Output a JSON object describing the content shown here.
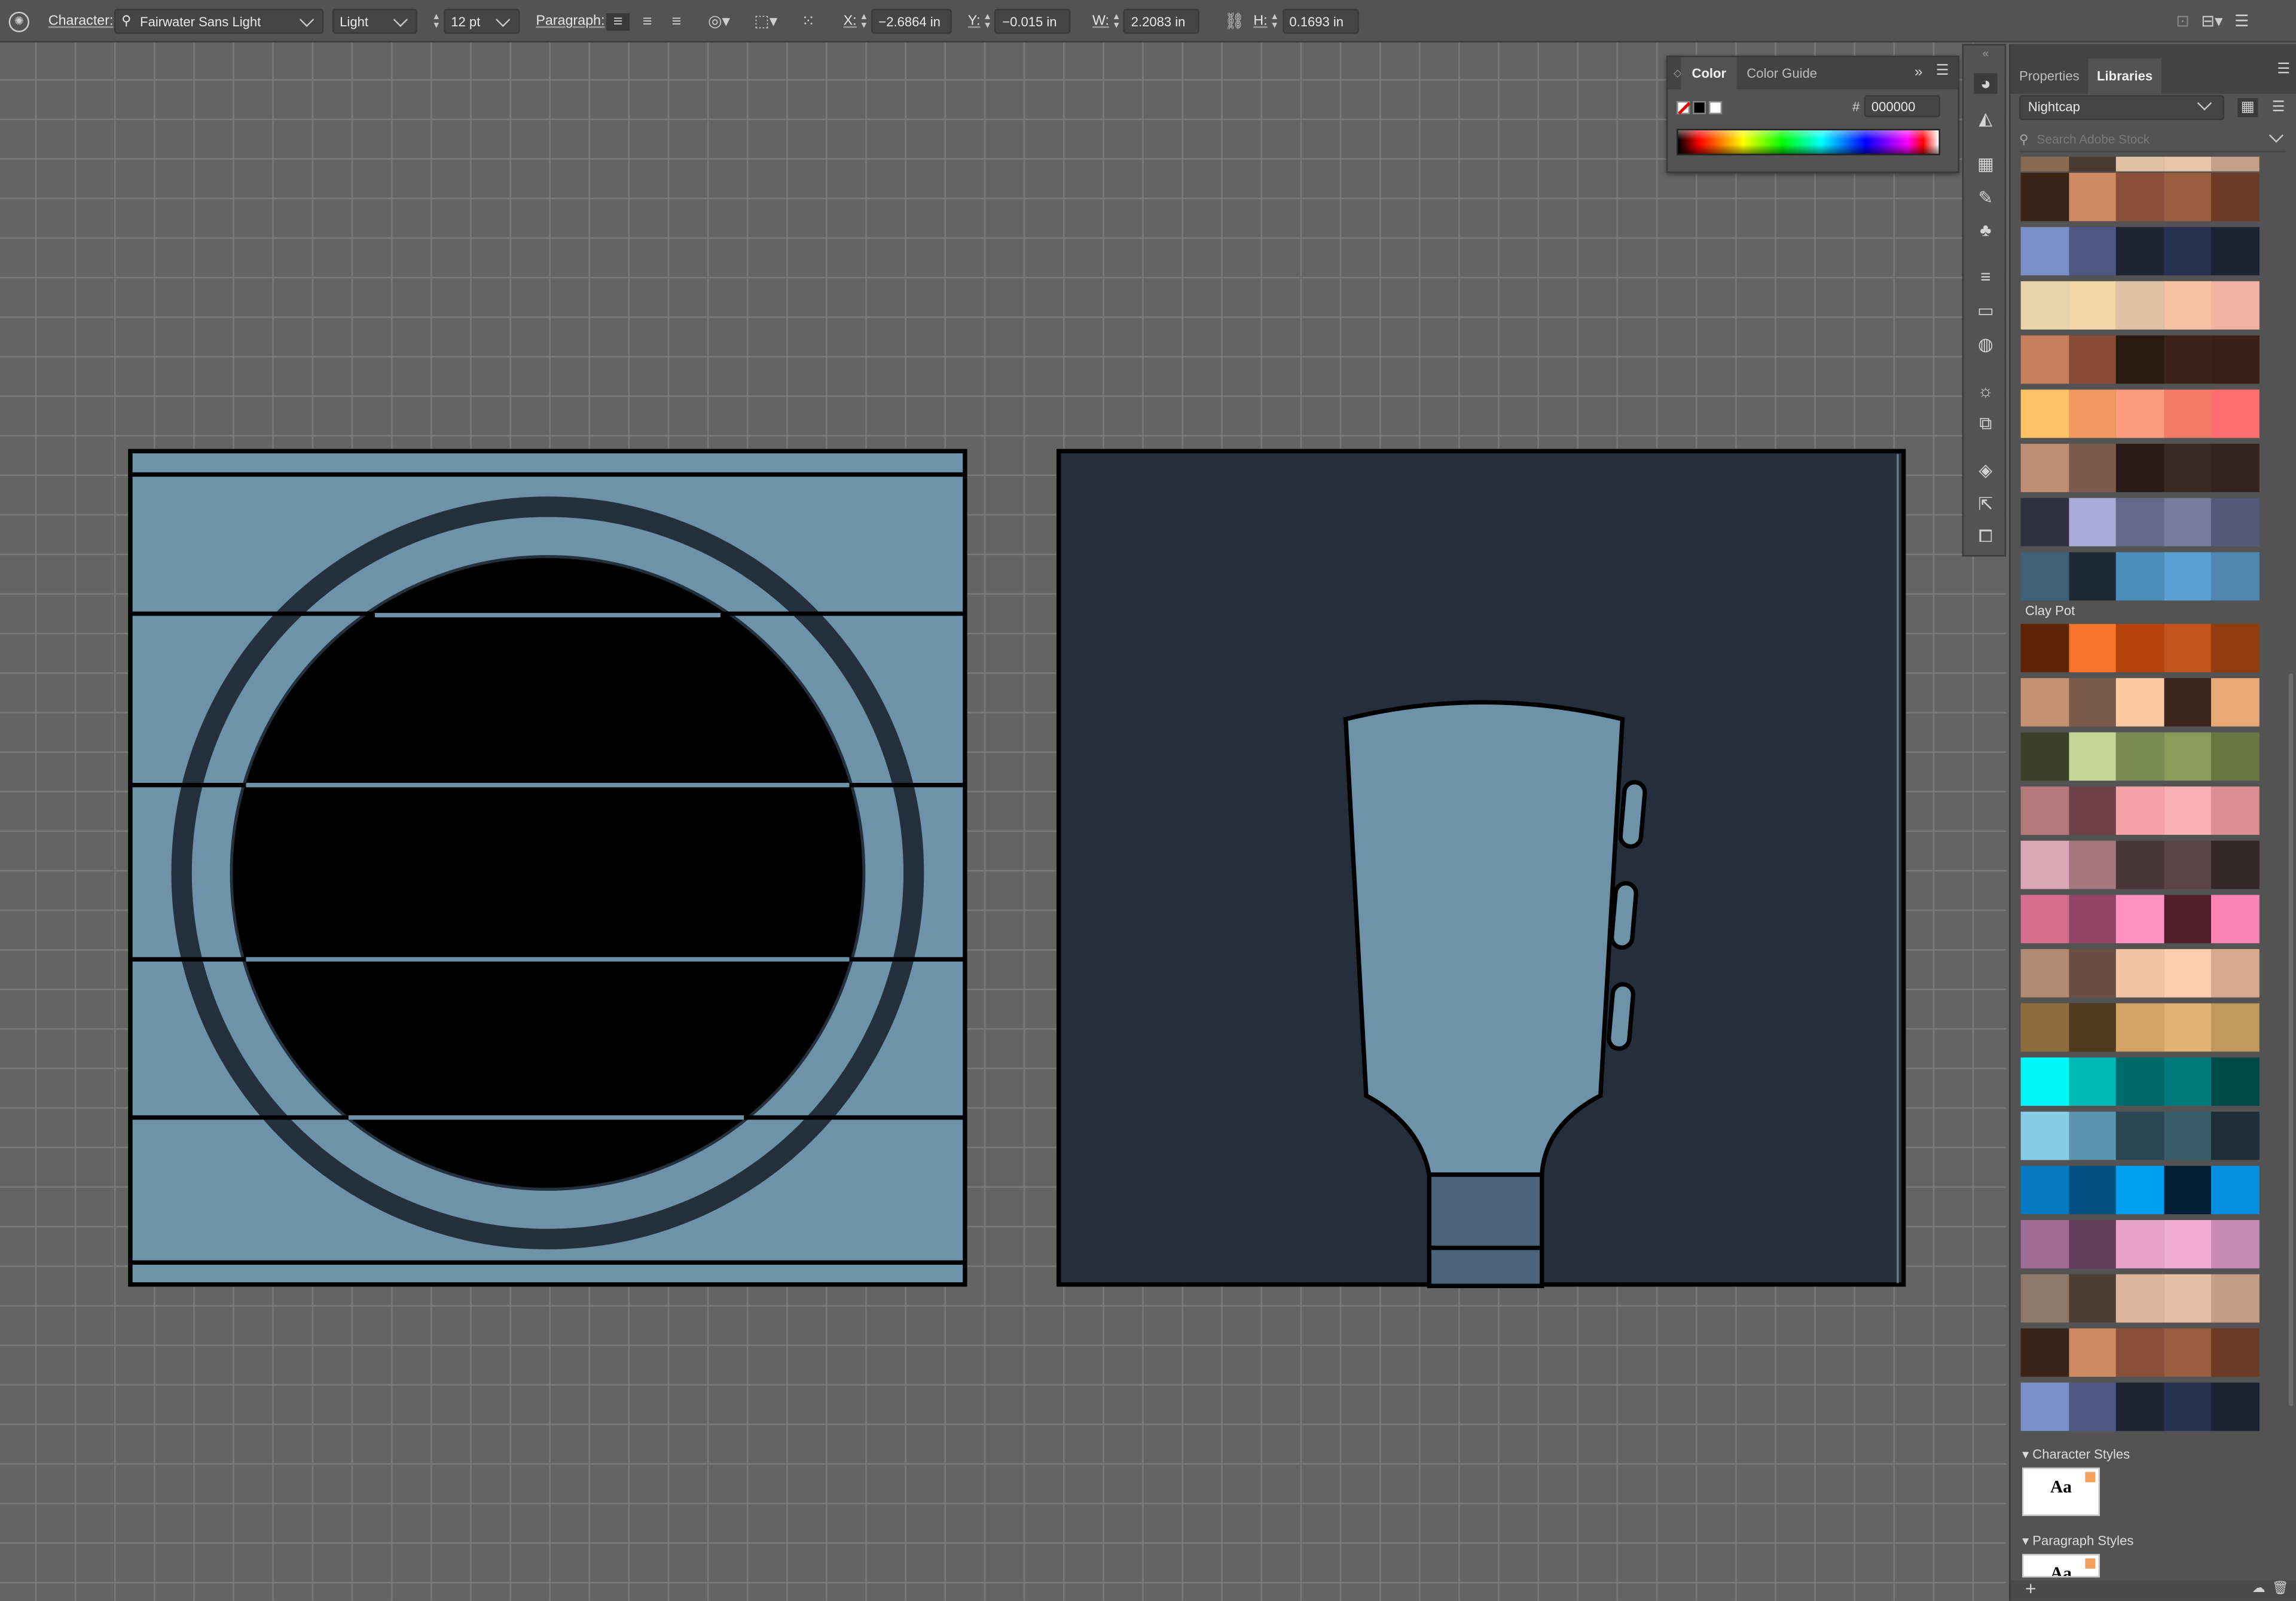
{
  "control_bar": {
    "character_label": "Character:",
    "font_family": "Fairwater Sans Light",
    "font_style": "Light",
    "font_size": "12 pt",
    "paragraph_label": "Paragraph:",
    "x_label": "X:",
    "x_value": "−2.6864 in",
    "y_label": "Y:",
    "y_value": "−0.015 in",
    "w_label": "W:",
    "w_value": "2.2083 in",
    "h_label": "H:",
    "h_value": "0.1693 in"
  },
  "color_panel": {
    "tabs": [
      "Color",
      "Color Guide"
    ],
    "hash": "#",
    "hex": "000000"
  },
  "right_panel": {
    "tabs": [
      "Properties",
      "Libraries"
    ],
    "library": "Nightcap",
    "search_placeholder": "Search Adobe Stock",
    "swatch_rows": [
      [
        "#3a2418",
        "#d08a63",
        "#8a5037",
        "#9a5d40",
        "#6d3b26"
      ],
      [
        "#7a8fc6",
        "#4c5886",
        "#1c2335",
        "#263250",
        "#1b2234"
      ],
      [
        "#e8d4a8",
        "#f3d6a7",
        "#e2c0a3",
        "#f8c3a3",
        "#f1b3a1"
      ],
      [
        "#c67d5a",
        "#884a36",
        "#2a1a12",
        "#3d2219",
        "#3a2017"
      ],
      [
        "#fec163",
        "#f0995e",
        "#fc9c7c",
        "#f27b66",
        "#ff6e6e"
      ],
      [
        "#be8d72",
        "#7d5b4a",
        "#2a1d18",
        "#3b2a24",
        "#33241f"
      ],
      [
        "#2f3140",
        "#a8acd6",
        "#646a8c",
        "#767ba0",
        "#555a7a"
      ],
      [
        "#3f6178",
        "#1c2a38",
        "#4b8cba",
        "#5a9fd2",
        "#4f87b0"
      ],
      [
        "#5e2408",
        "#f7732a",
        "#b3430b",
        "#c2531c",
        "#913b0e"
      ],
      [
        "#c49070",
        "#7a5a48",
        "#fcc8a0",
        "#3a261e",
        "#e8a979"
      ],
      [
        "#3c4028",
        "#c6d594",
        "#7b8a50",
        "#8c9a5c",
        "#6a7540"
      ],
      [
        "#b5787a",
        "#6e4146",
        "#f4a2a5",
        "#f9b0b2",
        "#de8e92"
      ],
      [
        "#dca8b8",
        "#a4787e",
        "#4a353a",
        "#5a4448",
        "#33272a"
      ],
      [
        "#d36e8e",
        "#944463",
        "#fc92bf",
        "#521e2e",
        "#fc84b4"
      ],
      [
        "#b18a72",
        "#6a4e40",
        "#f2c2a2",
        "#fcceae",
        "#d9a88b"
      ],
      [
        "#8e6c3c",
        "#50391c",
        "#d2a464",
        "#e2b273",
        "#c0975c"
      ],
      [
        "#00f7f7",
        "#00b8b4",
        "#006a6a",
        "#007a7a",
        "#004a4a"
      ],
      [
        "#86cce6",
        "#5a94ae",
        "#2a4654",
        "#385c6a",
        "#1d2f3a"
      ],
      [
        "#0478c0",
        "#015082",
        "#00a0f0",
        "#001e36",
        "#0890e0"
      ],
      [
        "#9e6c94",
        "#643c5e",
        "#e6a2cc",
        "#f0aad6",
        "#c68ab4"
      ],
      [
        "#8e7868",
        "#4c3e33",
        "#dcb69c",
        "#e6c0a6",
        "#c49e86"
      ],
      [
        "#3a2418",
        "#d08a63",
        "#8a5037",
        "#9a5d40",
        "#6d3b26"
      ],
      [
        "#7a8fc6",
        "#4c5886",
        "#1c2335",
        "#263250",
        "#1b2234"
      ]
    ],
    "group_label": "Clay Pot",
    "character_styles": "Character Styles",
    "paragraph_styles": "Paragraph Styles",
    "style_sample": "Aa"
  }
}
